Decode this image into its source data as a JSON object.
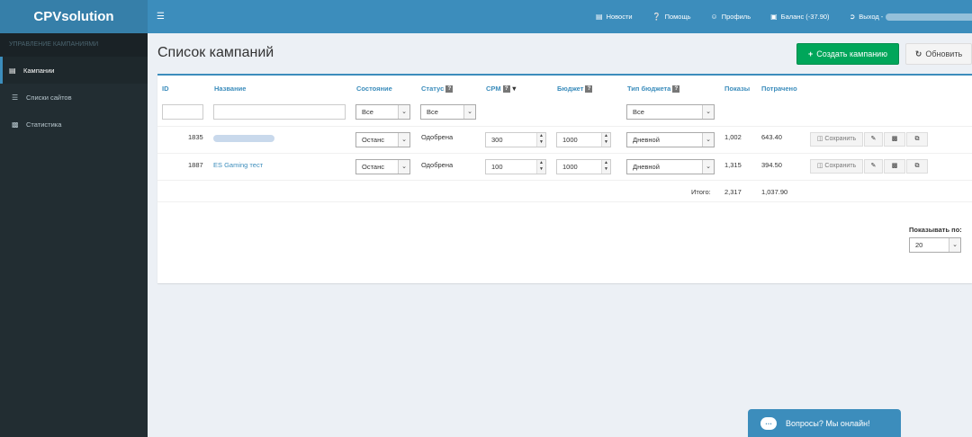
{
  "app": {
    "logo": "CPVsolution",
    "menu_icon": "hamburger-icon"
  },
  "topnav": {
    "news": "Новости",
    "help": "Помощь",
    "profile": "Профиль",
    "balance": "Баланс (-37.90)",
    "logout": "Выход -"
  },
  "sidebar": {
    "header": "УПРАВЛЕНИЕ КАМПАНИЯМИ",
    "items": [
      {
        "label": "Кампании",
        "icon": "list-icon",
        "active": true
      },
      {
        "label": "Списки сайтов",
        "icon": "list-ul-icon",
        "active": false
      },
      {
        "label": "Статистика",
        "icon": "bar-chart-icon",
        "active": false
      }
    ]
  },
  "page": {
    "title": "Список кампаний",
    "create_button": "Создать кампанию",
    "refresh_button": "Обновить"
  },
  "table": {
    "headers": {
      "id": "ID",
      "name": "Название",
      "state": "Состояние",
      "status": "Статус",
      "cpm": "CPM",
      "budget": "Бюджет",
      "budget_type": "Тип бюджета",
      "impressions": "Показы",
      "spent": "Потрачено"
    },
    "filters": {
      "state": "Все",
      "status": "Все",
      "budget_type": "Все"
    },
    "rows": [
      {
        "id": "1835",
        "name": "",
        "state": "Останс",
        "status": "Одобрена",
        "cpm": "300",
        "budget": "1000",
        "budget_type": "Дневной",
        "impressions": "1,002",
        "spent": "643.40"
      },
      {
        "id": "1887",
        "name": "ES Gaming тест",
        "state": "Останс",
        "status": "Одобрена",
        "cpm": "100",
        "budget": "1000",
        "budget_type": "Дневной",
        "impressions": "1,315",
        "spent": "394.50"
      }
    ],
    "actions": {
      "save": "Сохранить"
    },
    "total": {
      "label": "Итого:",
      "impressions": "2,317",
      "spent": "1,037.90"
    }
  },
  "pagination": {
    "label": "Показывать по:",
    "value": "20"
  },
  "chat": {
    "label": "Вопросы? Мы онлайн!"
  },
  "colors": {
    "primary": "#3c8dbc",
    "success": "#00a65a",
    "sidebar": "#222d32",
    "background": "#ecf0f5"
  }
}
